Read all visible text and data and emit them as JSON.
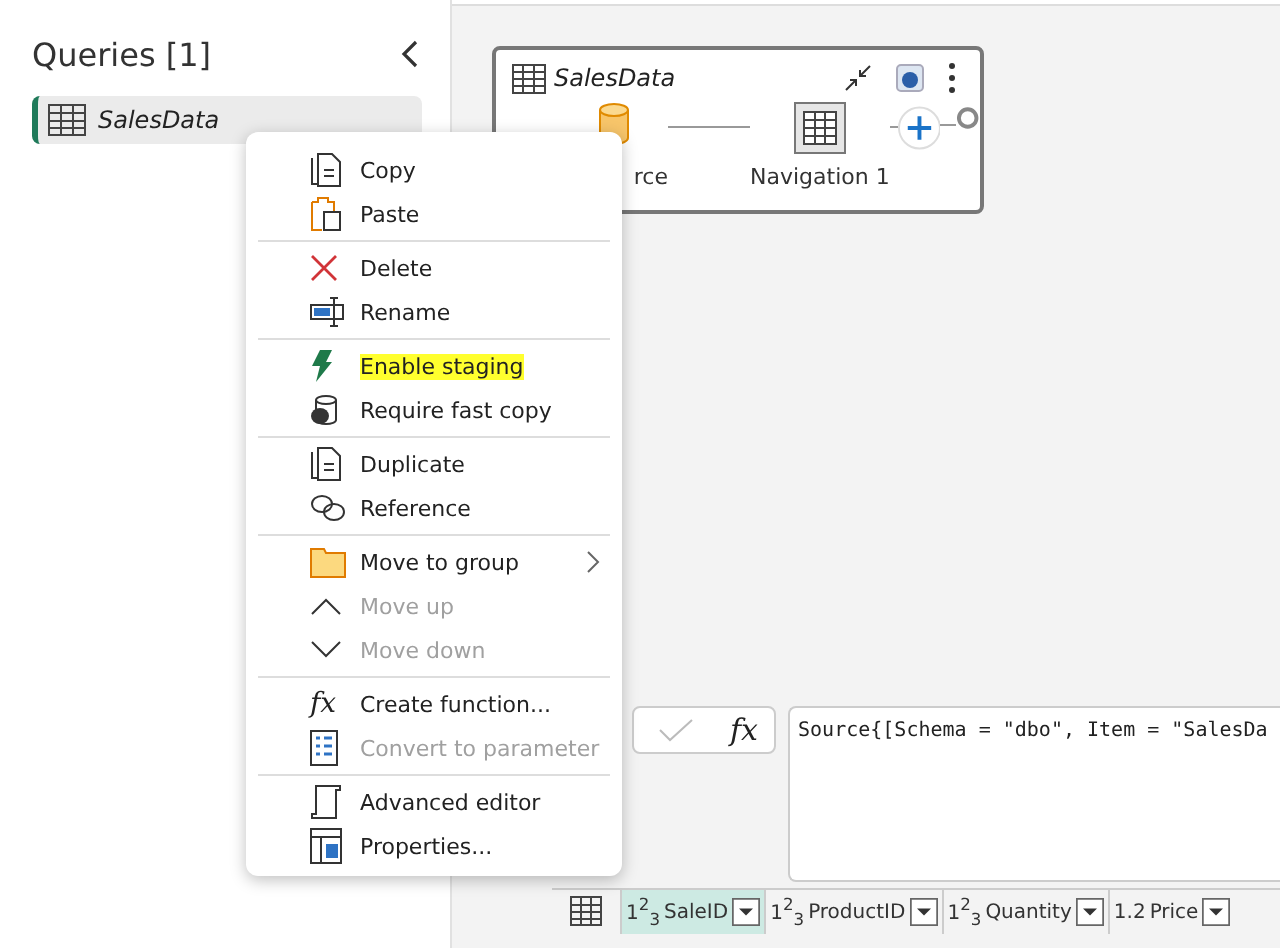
{
  "queries_panel": {
    "title": "Queries [1]",
    "items": [
      {
        "name": "SalesData",
        "selected": true
      }
    ]
  },
  "diagram": {
    "query_title": "SalesData",
    "steps": [
      {
        "kind": "source",
        "label": "rce"
      },
      {
        "kind": "table",
        "label": "Navigation 1"
      }
    ]
  },
  "context_menu": {
    "groups": [
      [
        {
          "kind": "copy",
          "label": "Copy",
          "disabled": false,
          "highlighted": false,
          "submenu": false
        },
        {
          "kind": "paste",
          "label": "Paste",
          "disabled": false,
          "highlighted": false,
          "submenu": false
        }
      ],
      [
        {
          "kind": "delete",
          "label": "Delete",
          "disabled": false,
          "highlighted": false,
          "submenu": false
        },
        {
          "kind": "rename",
          "label": "Rename",
          "disabled": false,
          "highlighted": false,
          "submenu": false
        }
      ],
      [
        {
          "kind": "bolt",
          "label": "Enable staging",
          "disabled": false,
          "highlighted": true,
          "submenu": false
        },
        {
          "kind": "db",
          "label": "Require fast copy",
          "disabled": false,
          "highlighted": false,
          "submenu": false
        }
      ],
      [
        {
          "kind": "copy",
          "label": "Duplicate",
          "disabled": false,
          "highlighted": false,
          "submenu": false
        },
        {
          "kind": "link",
          "label": "Reference",
          "disabled": false,
          "highlighted": false,
          "submenu": false
        }
      ],
      [
        {
          "kind": "folder",
          "label": "Move to group",
          "disabled": false,
          "highlighted": false,
          "submenu": true
        },
        {
          "kind": "up",
          "label": "Move up",
          "disabled": true,
          "highlighted": false,
          "submenu": false
        },
        {
          "kind": "down",
          "label": "Move down",
          "disabled": true,
          "highlighted": false,
          "submenu": false
        }
      ],
      [
        {
          "kind": "fx",
          "glyph": "fx",
          "label": "Create function...",
          "disabled": false,
          "highlighted": false,
          "submenu": false
        },
        {
          "kind": "param",
          "label": "Convert to parameter",
          "disabled": true,
          "highlighted": false,
          "submenu": false
        }
      ],
      [
        {
          "kind": "scroll",
          "label": "Advanced editor",
          "disabled": false,
          "highlighted": false,
          "submenu": false
        },
        {
          "kind": "props",
          "label": "Properties...",
          "disabled": false,
          "highlighted": false,
          "submenu": false
        }
      ]
    ]
  },
  "formula_bar": {
    "fx": "fx",
    "formula": "Source{[Schema = \"dbo\", Item = \"SalesDa"
  },
  "table": {
    "columns": [
      {
        "type": "1$^{2}$$_{3}$",
        "name": "SaleID",
        "selected": true
      },
      {
        "type": "1$^{2}$$_{3}$",
        "name": "ProductID",
        "selected": false
      },
      {
        "type": "1$^{2}$$_{3}$",
        "name": "Quantity",
        "selected": false
      },
      {
        "type": "1.2",
        "name": "Price",
        "selected": false
      }
    ]
  }
}
